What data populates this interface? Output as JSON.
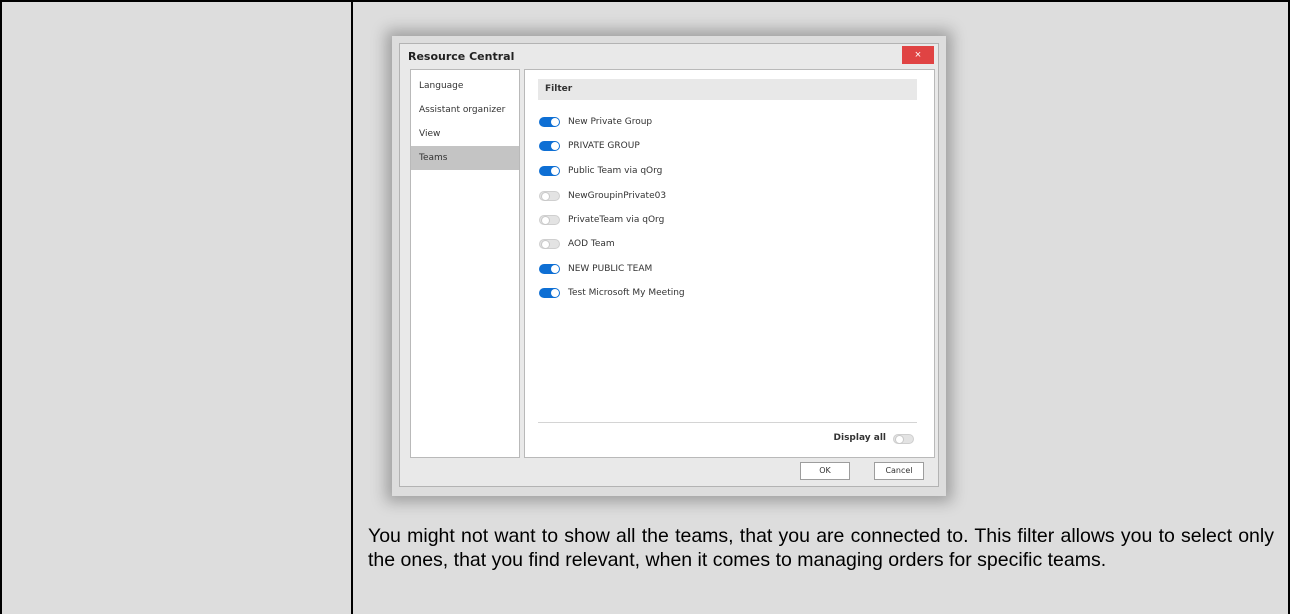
{
  "dialog": {
    "title": "Resource Central",
    "close_label": "×",
    "nav": [
      {
        "label": "Language",
        "active": false
      },
      {
        "label": "Assistant organizer",
        "active": false
      },
      {
        "label": "View",
        "active": false
      },
      {
        "label": "Teams",
        "active": true
      }
    ],
    "filter_label": "Filter",
    "teams": [
      {
        "label": "New Private Group",
        "enabled": true
      },
      {
        "label": "PRIVATE GROUP",
        "enabled": true
      },
      {
        "label": "Public Team via qOrg",
        "enabled": true
      },
      {
        "label": "NewGroupinPrivate03",
        "enabled": false
      },
      {
        "label": "PrivateTeam via qOrg",
        "enabled": false
      },
      {
        "label": "AOD Team",
        "enabled": false
      },
      {
        "label": "NEW PUBLIC TEAM",
        "enabled": true
      },
      {
        "label": "Test Microsoft My Meeting",
        "enabled": true
      }
    ],
    "display_all_label": "Display all",
    "display_all_enabled": false,
    "ok_label": "OK",
    "cancel_label": "Cancel"
  },
  "description": "You might not want to show all the teams, that you are connected to. This filter allows you to select only the ones, that you find relevant, when it comes to managing orders for specific teams."
}
